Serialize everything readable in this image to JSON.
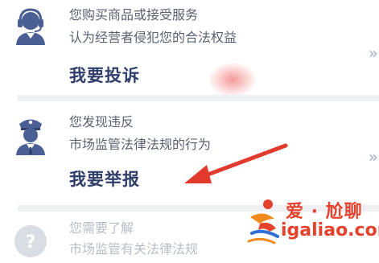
{
  "items": [
    {
      "line1": "您购买商品或接受服务",
      "line2": "认为经营者侵犯您的合法权益",
      "action": "我要投诉",
      "icon": "customer-service-icon"
    },
    {
      "line1": "您发现违反",
      "line2": "市场监管法律法规的行为",
      "action": "我要举报",
      "icon": "police-officer-icon"
    },
    {
      "line1": "您需要了解",
      "line2": "市场监管有关法律法规",
      "icon": "question-icon"
    }
  ],
  "chevron": "»",
  "watermark": {
    "brand": "爱 · 尬聊",
    "domain": "igaliao.com"
  },
  "colors": {
    "action_text": "#2f3e6b",
    "desc_text": "#5a6270",
    "icon_fill": "#4a5f93",
    "annotation_arrow": "#e23a2c",
    "watermark": "#e4422c"
  }
}
